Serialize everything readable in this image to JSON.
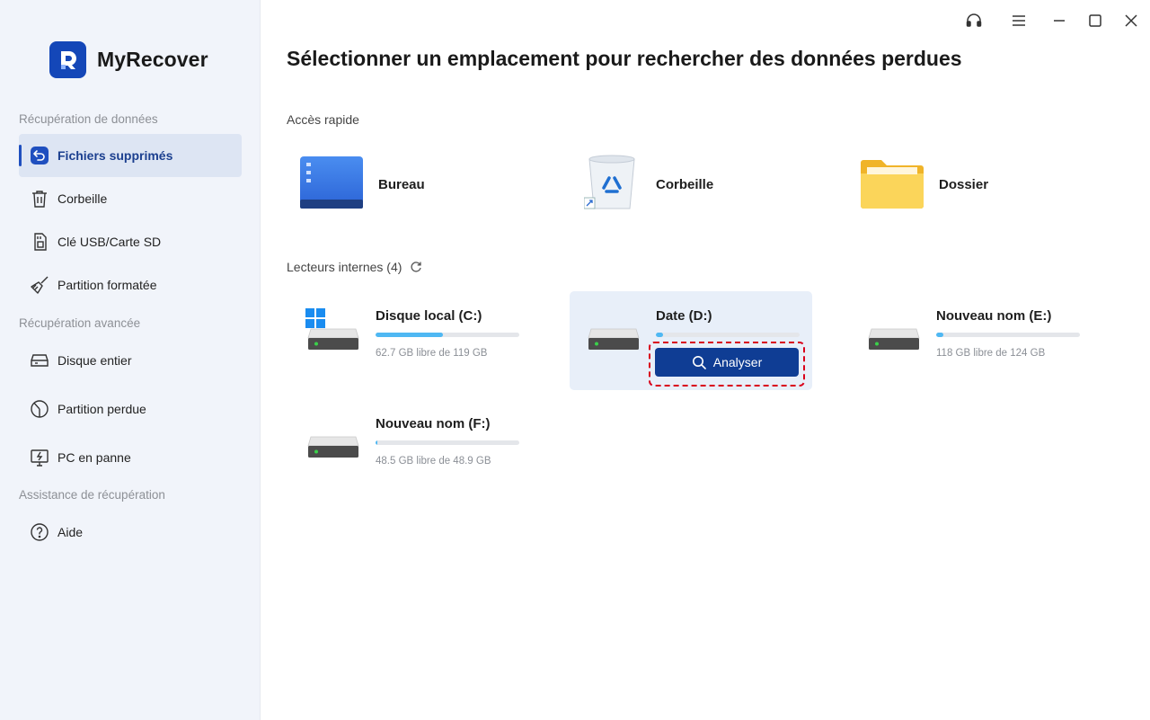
{
  "app": {
    "name": "MyRecover"
  },
  "sidebar": {
    "sections": [
      {
        "title": "Récupération de données"
      },
      {
        "title": "Récupération avancée"
      },
      {
        "title": "Assistance de récupération"
      }
    ],
    "items": [
      {
        "label": "Fichiers supprimés",
        "icon": "restore-file-icon",
        "active": true
      },
      {
        "label": "Corbeille",
        "icon": "trash-icon"
      },
      {
        "label": "Clé USB/Carte SD",
        "icon": "sd-card-icon"
      },
      {
        "label": "Partition formatée",
        "icon": "broom-icon"
      },
      {
        "label": "Disque entier",
        "icon": "hard-disk-icon"
      },
      {
        "label": "Partition perdue",
        "icon": "partition-icon"
      },
      {
        "label": "PC en panne",
        "icon": "crashed-pc-icon"
      },
      {
        "label": "Aide",
        "icon": "help-icon"
      }
    ]
  },
  "window_controls": [
    "support-headset-icon",
    "menu-icon",
    "minimize-icon",
    "maximize-icon",
    "close-icon"
  ],
  "main": {
    "title": "Sélectionner un emplacement pour rechercher des données perdues",
    "quick_access": {
      "label": "Accès rapide",
      "items": [
        {
          "label": "Bureau",
          "icon": "desktop-icon"
        },
        {
          "label": "Corbeille",
          "icon": "recycle-bin-icon"
        },
        {
          "label": "Dossier",
          "icon": "folder-icon"
        }
      ]
    },
    "drives_section": {
      "label": "Lecteurs internes (4)"
    },
    "drives": [
      {
        "name": "Disque local (C:)",
        "free": "62.7 GB libre de 119 GB",
        "used_fraction": 0.47,
        "windows": true
      },
      {
        "name": "Date (D:)",
        "free": "",
        "used_fraction": 0.05,
        "highlighted": true
      },
      {
        "name": "Nouveau nom (E:)",
        "free": "118 GB libre de 124 GB",
        "used_fraction": 0.05
      },
      {
        "name": "Nouveau nom (F:)",
        "free": "48.5 GB libre de 48.9 GB",
        "used_fraction": 0.01
      }
    ],
    "scan_button": {
      "label": "Analyser"
    }
  },
  "colors": {
    "accent": "#0f3d94",
    "sidebar_bg": "#f1f4fa",
    "bar_fill": "#4fb8f3",
    "highlight_border": "#d9001b"
  }
}
